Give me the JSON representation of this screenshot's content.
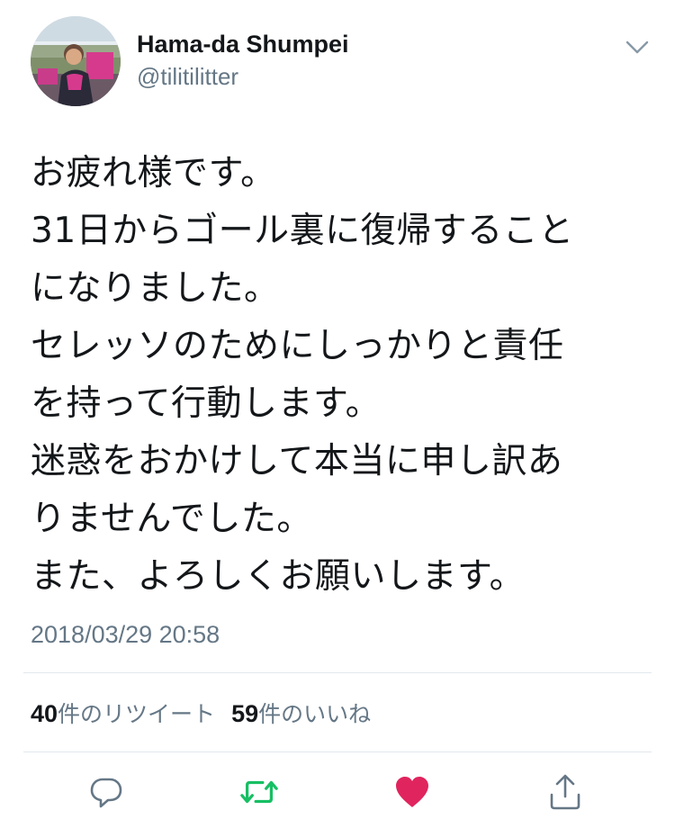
{
  "user": {
    "display_name": "Hama-da Shumpei",
    "handle": "@tilitilitter"
  },
  "tweet": {
    "lines": [
      "お疲れ様です。",
      "31日からゴール裏に復帰すること",
      "になりました。",
      "セレッソのためにしっかりと責任",
      "を持って行動します。",
      "迷惑をおかけして本当に申し訳あ",
      "りませんでした。",
      "また、よろしくお願いします。"
    ],
    "timestamp": "2018/03/29 20:58"
  },
  "stats": {
    "retweets_count": "40",
    "retweets_label": "件のリツイート",
    "likes_count": "59",
    "likes_label": "件のいいね"
  },
  "actions": [
    {
      "icon": "reply-icon",
      "color": "#657786"
    },
    {
      "icon": "retweet-icon",
      "color": "#17bf63"
    },
    {
      "icon": "like-heart-icon",
      "color": "#e0245e"
    },
    {
      "icon": "share-icon",
      "color": "#657786"
    }
  ],
  "colors": {
    "text_primary": "#14171a",
    "text_secondary": "#657786",
    "divider": "#e1e8ed",
    "retweet_green": "#17bf63",
    "like_red": "#e0245e"
  }
}
